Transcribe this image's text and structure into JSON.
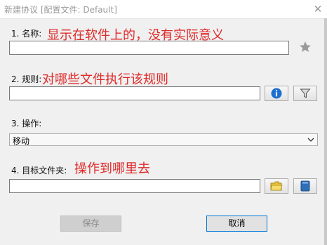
{
  "window": {
    "title": "新建协议 [配置文件: Default]"
  },
  "name_section": {
    "label": "1.  名称:",
    "annotation": "显示在软件上的，没有实际意义",
    "value": ""
  },
  "rule_section": {
    "label": "2.  规则:",
    "annotation": "对哪些文件执行该规则",
    "value": ""
  },
  "operation_section": {
    "label": "3.  操作:",
    "selected": "移动"
  },
  "target_section": {
    "label": "4.  目标文件夹:",
    "annotation": "操作到哪里去",
    "value": ""
  },
  "buttons": {
    "save": "保存",
    "cancel": "取消"
  },
  "icons": {
    "close": "close-icon",
    "favorite": "star-icon",
    "info": "info-icon",
    "filter": "filter-icon",
    "folder": "folder-icon",
    "book": "book-icon",
    "dropdown": "chevron-down-icon"
  },
  "colors": {
    "annotation": "#e02a2a",
    "info_blue": "#1a6fd0",
    "focus_border": "#0078d7"
  }
}
